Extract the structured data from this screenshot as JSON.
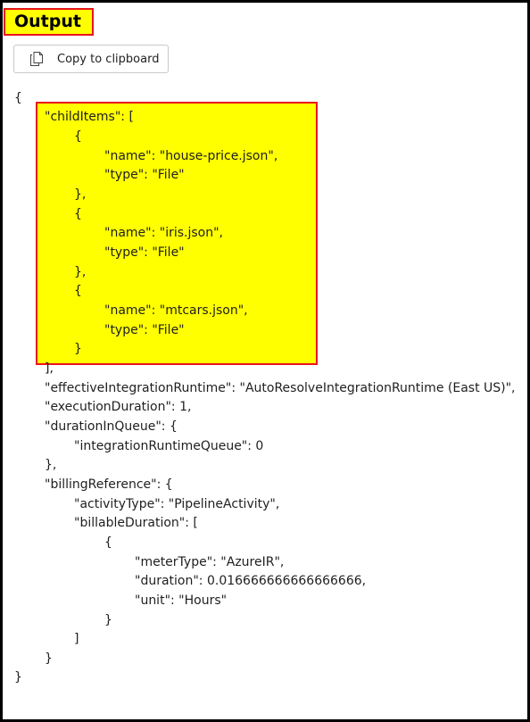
{
  "header": {
    "title": "Output",
    "highlight_color": "#ffff00",
    "border_color": "#e8141c"
  },
  "toolbar": {
    "copy_label": "Copy to clipboard",
    "copy_icon": "copy-icon"
  },
  "json_output": {
    "line_01": "{",
    "line_02": "\"childItems\": [",
    "line_03": "{",
    "line_04": "\"name\": \"house-price.json\",",
    "line_05": "\"type\": \"File\"",
    "line_06": "},",
    "line_07": "{",
    "line_08": "\"name\": \"iris.json\",",
    "line_09": "\"type\": \"File\"",
    "line_10": "},",
    "line_11": "{",
    "line_12": "\"name\": \"mtcars.json\",",
    "line_13": "\"type\": \"File\"",
    "line_14": "}",
    "line_15": "],",
    "line_16": "\"effectiveIntegrationRuntime\": \"AutoResolveIntegrationRuntime (East US)\",",
    "line_17": "\"executionDuration\": 1,",
    "line_18": "\"durationInQueue\": {",
    "line_19": "\"integrationRuntimeQueue\": 0",
    "line_20": "},",
    "line_21": "\"billingReference\": {",
    "line_22": "\"activityType\": \"PipelineActivity\",",
    "line_23": "\"billableDuration\": [",
    "line_24": "{",
    "line_25": "\"meterType\": \"AzureIR\",",
    "line_26": "\"duration\": 0.016666666666666666,",
    "line_27": "\"unit\": \"Hours\"",
    "line_28": "}",
    "line_29": "]",
    "line_30": "}",
    "line_31": "}"
  }
}
